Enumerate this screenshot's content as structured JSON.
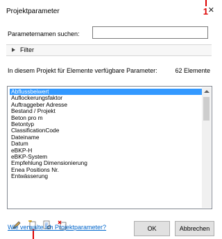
{
  "dialog": {
    "title": "Projektparameter",
    "close_glyph": "✕"
  },
  "annotations": {
    "top_marker": "1"
  },
  "search": {
    "label": "Parameternamen suchen:",
    "value": ""
  },
  "filter": {
    "label": "Filter"
  },
  "info": {
    "text": "In diesem Projekt für Elemente verfügbare Parameter:",
    "count": "62 Elemente"
  },
  "parameters": [
    "Abflussbeiwert",
    "Auflockerungsfaktor",
    "Auftraggeber Adresse",
    "Bestand / Projekt",
    "Beton pro m",
    "Betontyp",
    "ClassificationCode",
    "Dateiname",
    "Datum",
    "eBKP-H",
    "eBKP-System",
    "Empfehlung Dimensionierung",
    "Enea Positions Nr.",
    "Entwässerung"
  ],
  "toolbar": {
    "icons": [
      "edit-icon",
      "add-parameter-icon",
      "view-icon",
      "delete-icon"
    ]
  },
  "footer": {
    "help_link": "Wie verwalte ich Projektparameter?",
    "ok_label": "OK",
    "cancel_label": "Abbrechen"
  },
  "colors": {
    "selection": "#3399ff",
    "link": "#0066cc",
    "annotation": "#dd0000"
  }
}
